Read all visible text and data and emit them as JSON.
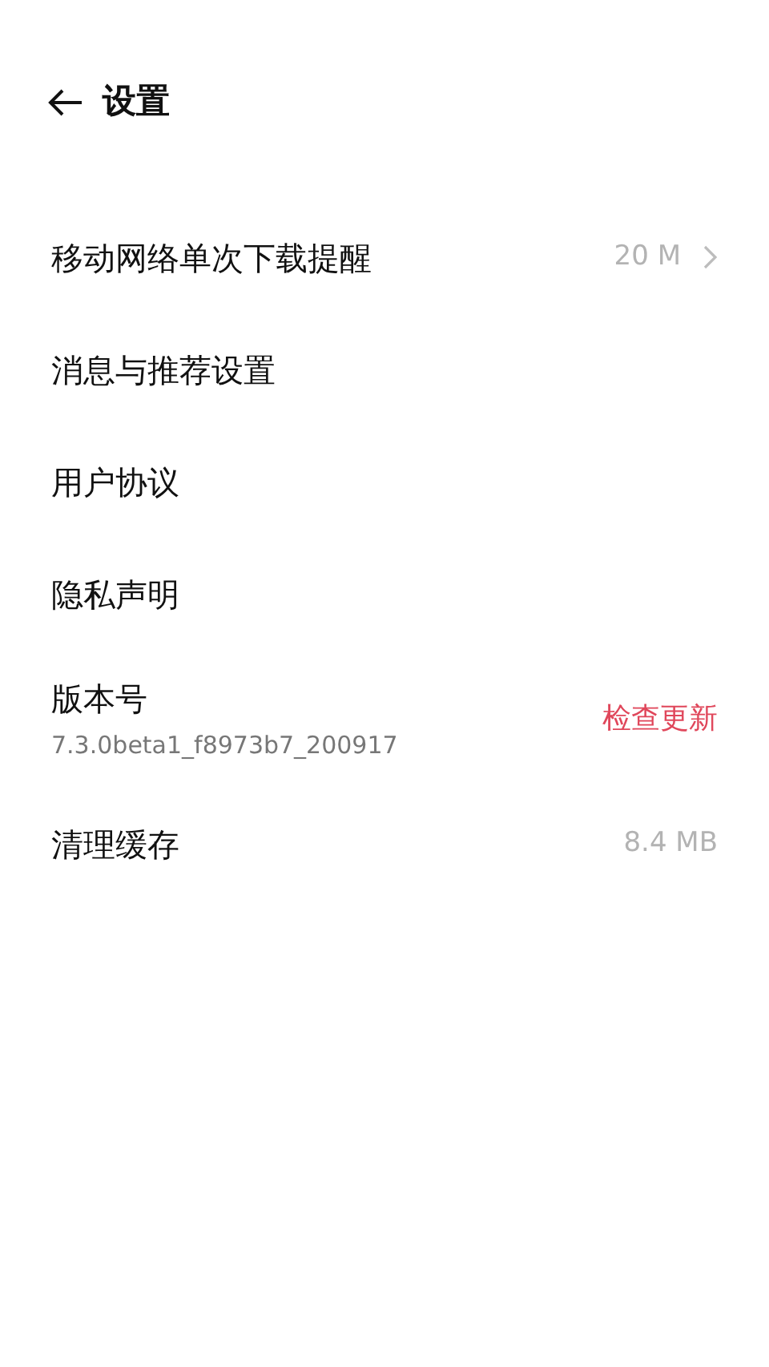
{
  "header": {
    "title": "设置"
  },
  "items": [
    {
      "kind": "link",
      "label": "移动网络单次下载提醒",
      "value": "20 M"
    },
    {
      "kind": "plain",
      "label": "消息与推荐设置"
    },
    {
      "kind": "plain",
      "label": "用户协议"
    },
    {
      "kind": "plain",
      "label": "隐私声明"
    },
    {
      "kind": "action",
      "label": "版本号",
      "subtitle": "7.3.0beta1_f8973b7_200917",
      "action": "检查更新"
    },
    {
      "kind": "info",
      "label": "清理缓存",
      "value": "8.4 MB"
    }
  ]
}
